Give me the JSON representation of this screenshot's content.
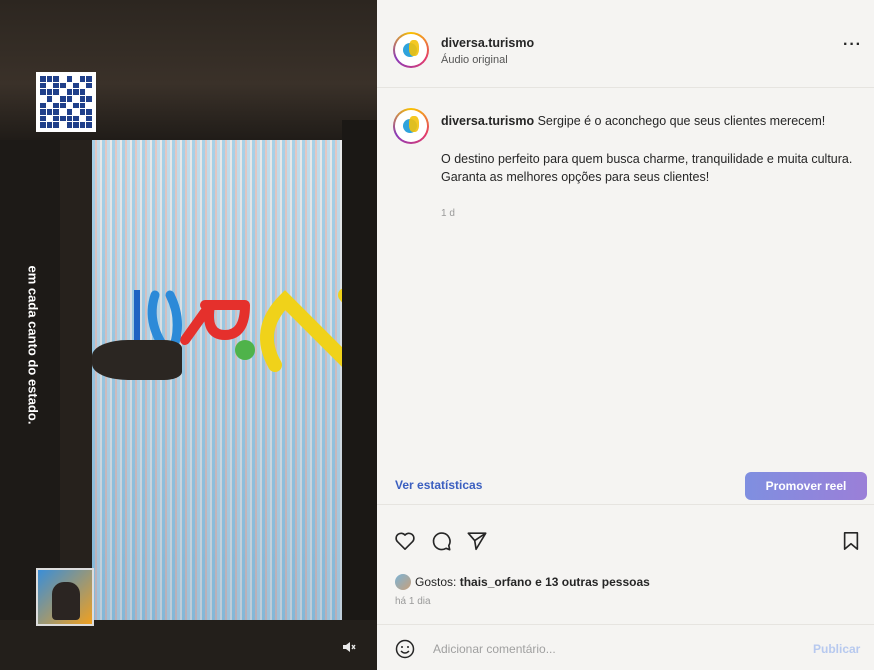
{
  "media": {
    "vertical_caption": "em cada canto do estado.",
    "mute_icon": "speaker-muted-icon"
  },
  "post": {
    "username": "diversa.turismo",
    "audio": "Áudio original",
    "more_icon": "more-horizontal-icon",
    "more_label": "···"
  },
  "caption": {
    "username": "diversa.turismo",
    "headline": "Sergipe é o aconchego que seus clientes merecem!",
    "body_line1": "O destino perfeito para quem busca charme, tranquilidade e muita cultura.",
    "body_line2": "Garanta as melhores opções para seus clientes!",
    "time": "1 d"
  },
  "insights": {
    "link_label": "Ver estatísticas",
    "promote_label": "Promover reel"
  },
  "actions": {
    "like_icon": "heart-icon",
    "comment_icon": "comment-icon",
    "share_icon": "send-icon",
    "save_icon": "bookmark-icon"
  },
  "likes": {
    "prefix": "Gostos:",
    "user": "thais_orfano",
    "suffix": "e 13 outras pessoas",
    "time_ago": "há 1 dia"
  },
  "comment": {
    "placeholder": "Adicionar comentário...",
    "publish_label": "Publicar",
    "emoji_icon": "emoji-icon"
  },
  "colors": {
    "link": "#3b5fc0",
    "promote": "#8a86dc",
    "publish_disabled": "#b7c9ef"
  }
}
